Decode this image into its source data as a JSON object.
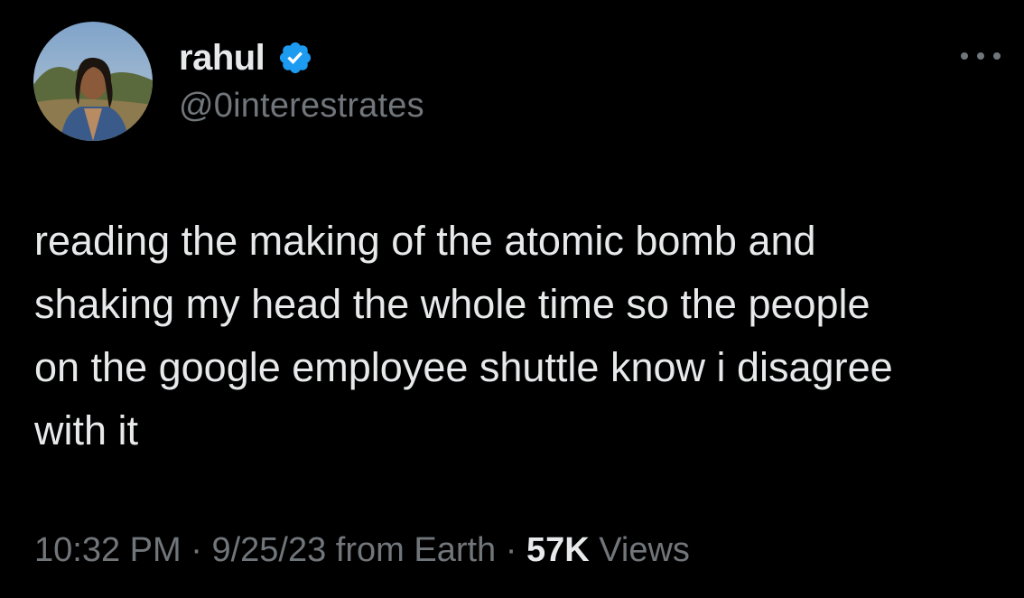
{
  "author": {
    "name": "rahul",
    "handle": "@0interestrates",
    "verified": true
  },
  "tweet": {
    "text": "reading the making of the atomic bomb and\nshaking my head the whole time so the people\non the google employee shuttle know i disagree\nwith it"
  },
  "meta": {
    "time": "10:32 PM",
    "separator1": " · ",
    "date": "9/25/23",
    "source": " from Earth",
    "separator2": " · ",
    "views_count": "57K",
    "views_label": " Views"
  },
  "colors": {
    "background": "#000000",
    "primary_text": "#e7e9ea",
    "secondary_text": "#71767b",
    "verified_badge": "#1d9bf0"
  },
  "icons": {
    "verified": "verified-badge-icon",
    "more": "more-options-icon"
  }
}
